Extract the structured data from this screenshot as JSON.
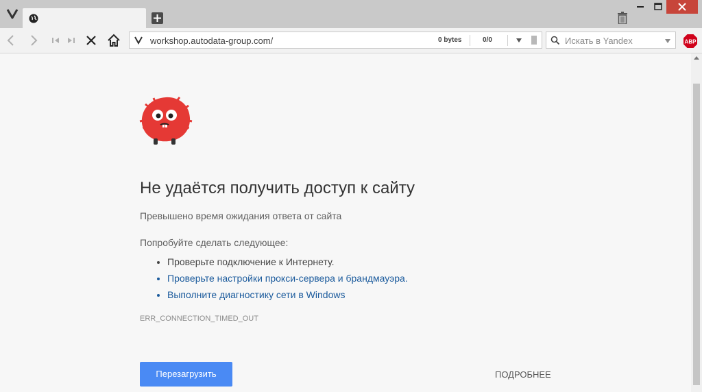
{
  "window": {
    "tab_title": "",
    "url": "workshop.autodata-group.com/",
    "bytes": "0 bytes",
    "count": "0/0",
    "search_placeholder": "Искать в Yandex",
    "abp_label": "ABP",
    "colors": {
      "tab_strip": "#c9c9c9",
      "close_button": "#c7453a",
      "abp": "#d0021b"
    },
    "icons": [
      "vivaldi-logo-icon",
      "globe-icon",
      "new-tab-icon",
      "trash-icon",
      "minimize-icon",
      "maximize-icon",
      "close-icon",
      "back-icon",
      "forward-icon",
      "rewind-icon",
      "fast-forward-icon",
      "stop-icon",
      "home-icon",
      "search-icon",
      "abp-icon"
    ]
  },
  "error_page": {
    "title": "Не удаётся получить доступ к сайту",
    "subtitle": "Превышено время ожидания ответа от сайта",
    "try_label": "Попробуйте сделать следующее:",
    "suggestions": [
      {
        "text": "Проверьте подключение к Интернету.",
        "is_link": false
      },
      {
        "text": "Проверьте настройки прокси-сервера и брандмауэра.",
        "is_link": true
      },
      {
        "text": "Выполните диагностику сети в Windows",
        "is_link": true
      }
    ],
    "error_code": "ERR_CONNECTION_TIMED_OUT",
    "reload_label": "Перезагрузить",
    "details_label": "ПОДРОБНЕЕ",
    "colors": {
      "link": "#1a5a9c",
      "button": "#4a8af4",
      "mascot": "#e53935"
    }
  }
}
